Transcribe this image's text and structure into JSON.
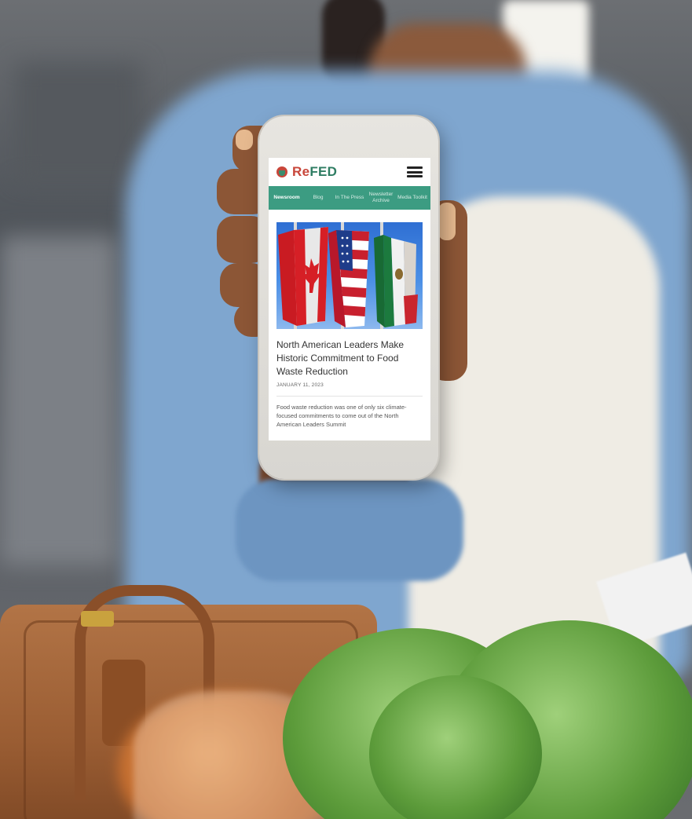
{
  "colors": {
    "brand_red": "#c8463a",
    "brand_green": "#2f7d63",
    "nav_teal": "#3c9c82"
  },
  "phone_app": {
    "logo": {
      "re": "Re",
      "fed": "FED"
    },
    "menu_icon": "hamburger-menu-icon",
    "nav": [
      {
        "label": "Newsroom",
        "active": true
      },
      {
        "label": "Blog",
        "active": false
      },
      {
        "label": "In The Press",
        "active": false
      },
      {
        "label": "Newsletter Archive",
        "active": false
      },
      {
        "label": "Media Toolkit",
        "active": false
      }
    ],
    "article": {
      "image_subject": "canada-usa-mexico-flags",
      "title": "North American Leaders Make Historic Commitment to Food Waste Reduction",
      "date": "JANUARY 11, 2023",
      "excerpt": "Food waste reduction was one of only six climate-focused commitments to come out of the North American Leaders Summit"
    }
  }
}
